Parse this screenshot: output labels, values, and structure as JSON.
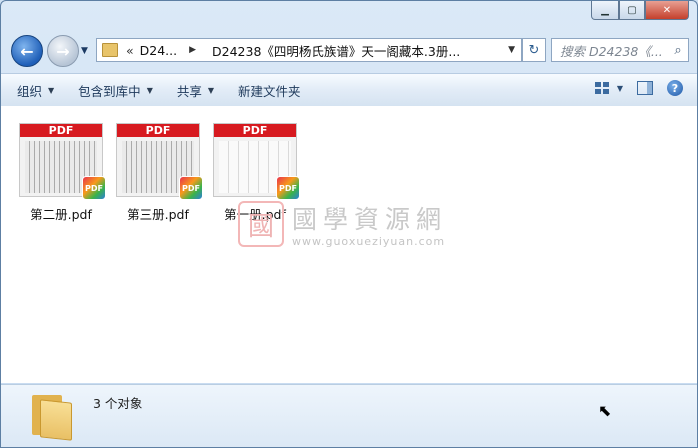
{
  "window": {
    "controls": {
      "minimize": "▁",
      "maximize": "▢",
      "close": "✕"
    }
  },
  "navigation": {
    "back_icon": "back-arrow-icon",
    "forward_icon": "forward-arrow-icon",
    "address": {
      "chevron": "«",
      "segment1": "D24...",
      "segment2": "D24238《四明杨氏族谱》天一阁藏本.3册..."
    },
    "search_placeholder": "搜索 D24238《..."
  },
  "toolbar": {
    "items": [
      "组织",
      "包含到库中",
      "共享",
      "新建文件夹"
    ]
  },
  "files": [
    {
      "name": "第二册.pdf",
      "thumb_label": "PDF",
      "badge": "PDF"
    },
    {
      "name": "第三册.pdf",
      "thumb_label": "PDF",
      "badge": "PDF"
    },
    {
      "name": "第一册.pdf",
      "thumb_label": "PDF",
      "badge": "PDF"
    }
  ],
  "watermark": {
    "seal": "國",
    "title": "國學資源網",
    "url": "www.guoxueziyuan.com"
  },
  "status": {
    "count_text": "3 个对象"
  },
  "colors": {
    "pdf_red": "#d71a20",
    "accent_blue": "#1f5fb8"
  }
}
